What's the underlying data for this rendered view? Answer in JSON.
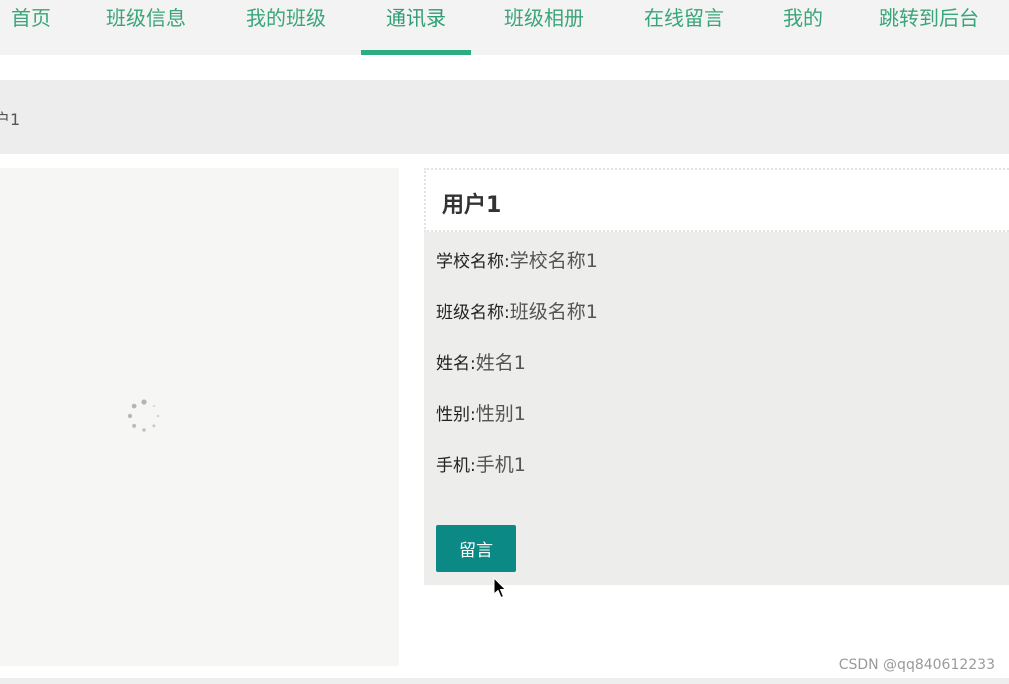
{
  "nav": {
    "items": [
      {
        "label": "首页"
      },
      {
        "label": "班级信息"
      },
      {
        "label": "我的班级"
      },
      {
        "label": "通讯录",
        "active": true
      },
      {
        "label": "班级相册"
      },
      {
        "label": "在线留言"
      },
      {
        "label": "我的"
      },
      {
        "label": "跳转到后台"
      }
    ]
  },
  "breadcrumb": {
    "text": "户1"
  },
  "profile": {
    "name": "用户1",
    "fields": [
      {
        "label": "学校名称:",
        "value": "学校名称1"
      },
      {
        "label": "班级名称:",
        "value": "班级名称1"
      },
      {
        "label": "姓名:",
        "value": "姓名1"
      },
      {
        "label": "性别:",
        "value": "性别1"
      },
      {
        "label": "手机:",
        "value": "手机1"
      }
    ],
    "message_button": "留言"
  },
  "image_panel": {
    "icon": "loading-spinner-icon"
  },
  "watermark": "CSDN @qq840612233",
  "colors": {
    "nav_text": "#3aa57a",
    "nav_active_underline": "#2bad7f",
    "button_bg": "#0b8a85",
    "panel_bg": "#ededec"
  }
}
